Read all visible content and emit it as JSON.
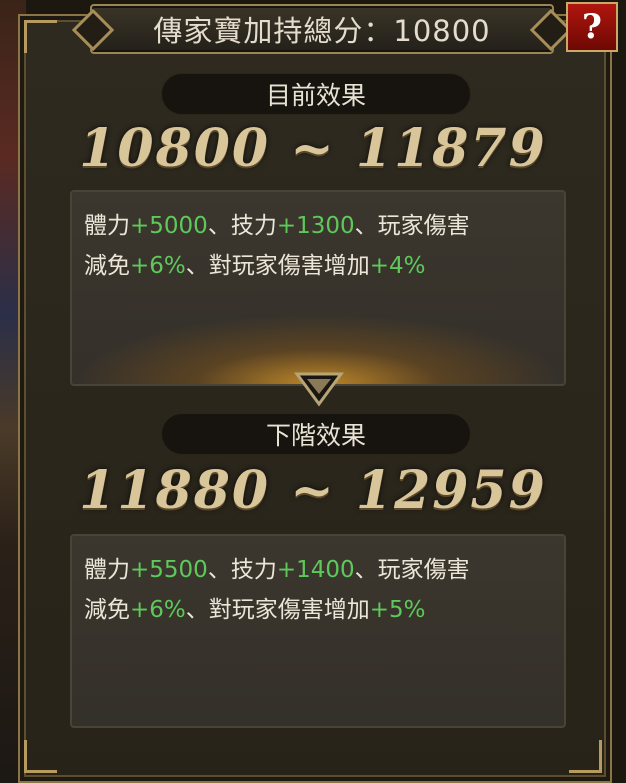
{
  "title": {
    "label": "傳家寶加持總分：",
    "score": "10800"
  },
  "help": {
    "label": "?"
  },
  "current": {
    "section_label": "目前效果",
    "range": "10800 ~ 11879",
    "line1": {
      "a": "體力",
      "a_val": "+5000",
      "sep1": "、",
      "b": "技力",
      "b_val": "+1300",
      "sep2": "、",
      "c": "玩家傷害"
    },
    "line2": {
      "d": "減免",
      "d_val": "+6%",
      "sep3": "、",
      "e": "對玩家傷害增加",
      "e_val": "+4%"
    }
  },
  "next": {
    "section_label": "下階效果",
    "range": "11880 ~ 12959",
    "line1": {
      "a": "體力",
      "a_val": "+5500",
      "sep1": "、",
      "b": "技力",
      "b_val": "+1400",
      "sep2": "、",
      "c": "玩家傷害"
    },
    "line2": {
      "d": "減免",
      "d_val": "+6%",
      "sep3": "、",
      "e": "對玩家傷害增加",
      "e_val": "+5%"
    }
  },
  "colors": {
    "bonus_value": "#5ec95a",
    "gold_text": "#d8c59a",
    "help_button": "#b0160e"
  },
  "icons": {
    "help": "question-mark-icon",
    "arrow": "chevron-down-icon"
  }
}
